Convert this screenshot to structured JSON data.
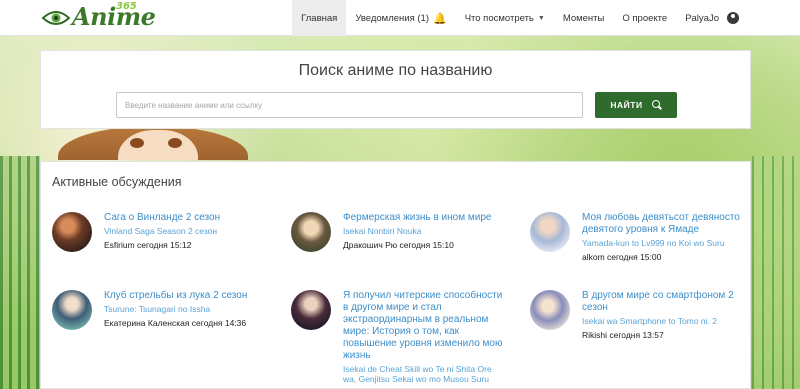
{
  "header": {
    "logo_text": "Anime",
    "logo_number": "365",
    "nav": [
      {
        "label": "Главная",
        "active": true
      },
      {
        "label": "Уведомления (1)"
      },
      {
        "label": "Что посмотреть"
      },
      {
        "label": "Моменты"
      },
      {
        "label": "О проекте"
      },
      {
        "label": "PalyaJo"
      }
    ]
  },
  "search": {
    "title": "Поиск аниме по названию",
    "placeholder": "Введите название аниме или ссылку",
    "button_label": "НАЙТИ"
  },
  "discussions": {
    "title": "Активные обсуждения",
    "items": [
      {
        "title": "Сага о Винланде 2 сезон",
        "subtitle": "Vinland Saga Season 2 сезон",
        "meta": "Esfirium сегодня 15:12"
      },
      {
        "title": "Фермерская жизнь в ином мире",
        "subtitle": "Isekai Nonbiri Nouka",
        "meta": "Дракошич Рю сегодня 15:10"
      },
      {
        "title": "Моя любовь девятьсот девяносто девятого уровня к Ямаде",
        "subtitle": "Yamada-kun to Lv999 no Koi wo Suru",
        "meta": "alkom сегодня 15:00"
      },
      {
        "title": "Клуб стрельбы из лука 2 сезон",
        "subtitle": "Tsurune: Tsunagari no Issha",
        "meta": "Екатерина Каленская сегодня 14:36"
      },
      {
        "title": "Я получил читерские способности в другом мире и стал экстраординарным в реальном мире: История о том, как повышение уровня изменило мою жизнь",
        "subtitle": "Isekai de Cheat Skill wo Te ni Shita Ore wa, Genjitsu Sekai wo mo Musou Suru",
        "meta": ""
      },
      {
        "title": "В другом мире со смартфоном 2 сезон",
        "subtitle": "Isekai wa Smartphone to Tomo ni. 2",
        "meta": "Rikishi сегодня 13:57"
      }
    ]
  }
}
